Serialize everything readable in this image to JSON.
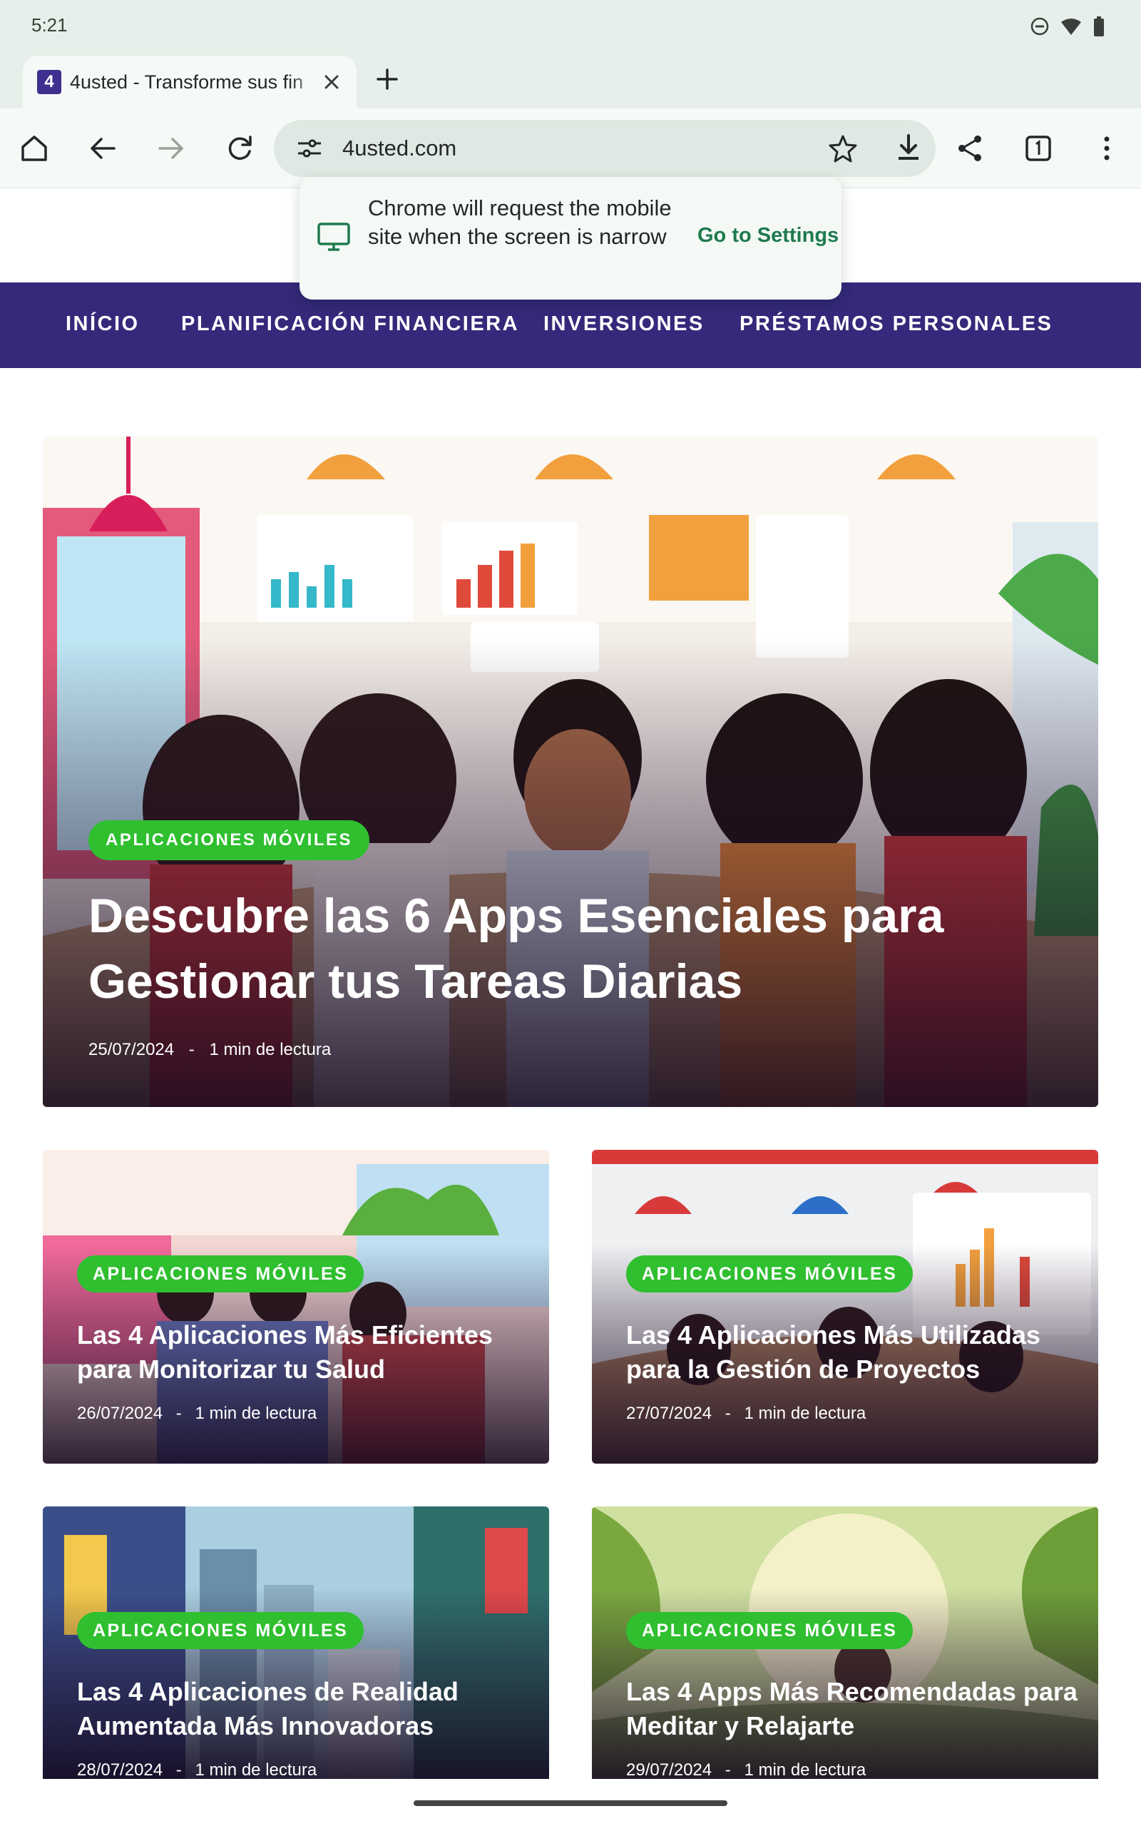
{
  "status_bar": {
    "time": "5:21"
  },
  "browser": {
    "tab": {
      "favicon": "4",
      "title": "4usted - Transforme sus fin"
    },
    "url": "4usted.com"
  },
  "popup": {
    "message": "Chrome will request the mobile site when the screen is narrow",
    "action": "Go to Settings"
  },
  "nav": {
    "items": [
      {
        "label": "INÍCIO"
      },
      {
        "label": "PLANIFICACIÓN FINANCIERA"
      },
      {
        "label": "INVERSIONES"
      },
      {
        "label": "PRÉSTAMOS PERSONALES"
      }
    ]
  },
  "hero": {
    "category": "APLICACIONES MÓVILES",
    "title": "Descubre las 6 Apps Esenciales para Gestionar tus Tareas Diarias",
    "date": "25/07/2024",
    "read_time": "1 min de lectura"
  },
  "posts": [
    {
      "category": "APLICACIONES MÓVILES",
      "title": "Las 4 Aplicaciones Más Eficientes para Monitorizar tu Salud",
      "date": "26/07/2024",
      "read_time": "1 min de lectura"
    },
    {
      "category": "APLICACIONES MÓVILES",
      "title": "Las 4 Aplicaciones Más Utilizadas para la Gestión de Proyectos",
      "date": "27/07/2024",
      "read_time": "1 min de lectura"
    },
    {
      "category": "APLICACIONES MÓVILES",
      "title": "Las 4 Aplicaciones de Realidad Aumentada Más Innovadoras",
      "date": "28/07/2024",
      "read_time": "1 min de lectura"
    },
    {
      "category": "APLICACIONES MÓVILES",
      "title": "Las 4 Apps Más Recomendadas para Meditar y Relajarte",
      "date": "29/07/2024",
      "read_time": "1 min de lectura"
    }
  ],
  "colors": {
    "nav_bg": "#34297a",
    "badge_bg": "#2fbf2f",
    "link_green": "#1e7a4e"
  },
  "meta_separator": "-"
}
